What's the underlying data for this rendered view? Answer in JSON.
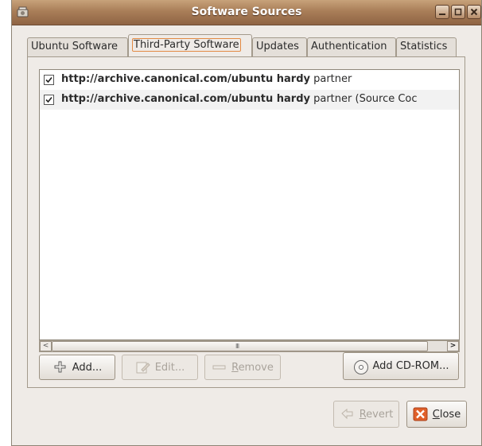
{
  "window": {
    "title": "Software Sources"
  },
  "tabs": [
    {
      "label": "Ubuntu Software"
    },
    {
      "label": "Third-Party Software"
    },
    {
      "label": "Updates"
    },
    {
      "label": "Authentication"
    },
    {
      "label": "Statistics"
    }
  ],
  "sources": [
    {
      "checked": true,
      "url": "http://archive.canonical.com/ubuntu hardy",
      "component": " partner"
    },
    {
      "checked": true,
      "url": "http://archive.canonical.com/ubuntu hardy",
      "component": " partner (Source Coc"
    }
  ],
  "buttons": {
    "add": "Add...",
    "edit": "Edit...",
    "remove_pre": "",
    "remove_mnemonic": "R",
    "remove_post": "emove",
    "add_cdrom": "Add CD-ROM...",
    "revert_mnemonic": "R",
    "revert_post": "evert",
    "close_mnemonic": "C",
    "close_post": "lose"
  },
  "scrollbar": {
    "left_arrow": "<",
    "right_arrow": ">",
    "grip": "III"
  },
  "icons": {
    "window": "software-sources-icon",
    "minimize": "minimize-icon",
    "maximize": "maximize-icon",
    "close": "close-icon",
    "add": "plus-icon",
    "edit": "edit-icon",
    "remove": "minus-icon",
    "cdrom": "cdrom-icon",
    "revert": "revert-icon",
    "close_btn": "close-x-icon"
  },
  "colors": {
    "titlebar": "#a97e58",
    "tab_focus": "#e38a43",
    "close_icon": "#e0602a"
  }
}
